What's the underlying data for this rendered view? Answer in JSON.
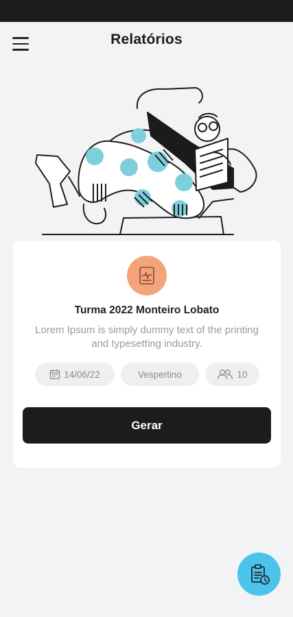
{
  "header": {
    "title": "Relatórios",
    "menu_icon": "hamburger-menu-icon"
  },
  "illustration": {
    "name": "person-reading-illustration",
    "accent_color": "#7ecfdc"
  },
  "card": {
    "badge_icon": "report-document-icon",
    "badge_color": "#f3a47a",
    "title": "Turma 2022 Monteiro Lobato",
    "description": "Lorem Ipsum is simply dummy text of the printing and typesetting industry.",
    "chips": {
      "date": "14/06/22",
      "period": "Vespertino",
      "students": "10"
    },
    "button_label": "Gerar"
  },
  "fab": {
    "icon": "clipboard-clock-icon",
    "color": "#4cc3ea"
  }
}
